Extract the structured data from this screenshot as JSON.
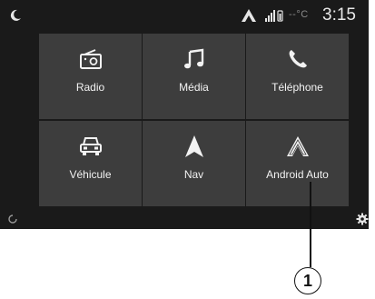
{
  "status_bar": {
    "temperature": "--°C",
    "time": "3:15"
  },
  "icons": {
    "night_mode": "moon-icon",
    "android_auto_status": "android-auto-icon",
    "signal": "signal-icon",
    "bottom_left": "circle-icon",
    "settings": "gear-icon"
  },
  "tiles": [
    {
      "label": "Radio",
      "icon": "radio-icon"
    },
    {
      "label": "Média",
      "icon": "music-note-icon"
    },
    {
      "label": "Téléphone",
      "icon": "phone-icon"
    },
    {
      "label": "Véhicule",
      "icon": "car-icon"
    },
    {
      "label": "Nav",
      "icon": "navigation-arrow-icon"
    },
    {
      "label": "Android Auto",
      "icon": "android-auto-icon"
    }
  ],
  "callout": {
    "number": "1"
  },
  "colors": {
    "screen_bg": "#1a1a1a",
    "tile_bg": "#3d3d3d",
    "text": "#f2f2f2"
  }
}
